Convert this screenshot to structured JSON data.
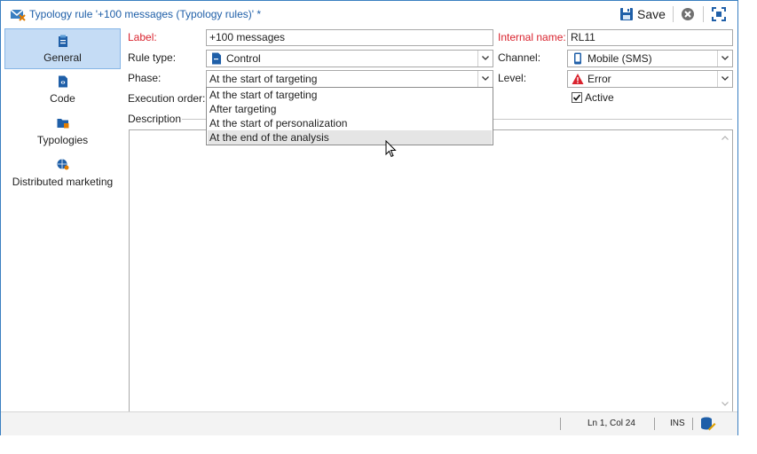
{
  "window": {
    "title": "Typology rule '+100 messages (Typology rules)' *"
  },
  "toolbar": {
    "save_label": "Save"
  },
  "sidebar": {
    "items": [
      {
        "label": "General",
        "icon": "clipboard-icon",
        "active": true
      },
      {
        "label": "Code",
        "icon": "code-document-icon",
        "active": false
      },
      {
        "label": "Typologies",
        "icon": "folder-icon",
        "active": false
      },
      {
        "label": "Distributed marketing",
        "icon": "globe-user-icon",
        "active": false
      }
    ]
  },
  "form": {
    "label_caption": "Label:",
    "label_value": "+100 messages",
    "internal_name_caption": "Internal name:",
    "internal_name_value": "RL11",
    "rule_type_caption": "Rule type:",
    "rule_type_value": "Control",
    "channel_caption": "Channel:",
    "channel_value": "Mobile (SMS)",
    "phase_caption": "Phase:",
    "phase_value": "At the start of targeting",
    "level_caption": "Level:",
    "level_value": "Error",
    "execution_order_caption": "Execution order:",
    "active_label": "Active",
    "active_checked": true,
    "description_caption": "Description"
  },
  "phase_dropdown": {
    "options": [
      "At the start of targeting",
      "After targeting",
      "At the start of personalization",
      "At the end of the analysis"
    ],
    "hovered_index": 3
  },
  "statusbar": {
    "position": "Ln 1, Col 24",
    "mode": "INS"
  },
  "colors": {
    "accent": "#1f5fa8",
    "required": "#d9232e",
    "active_nav_bg": "#c5dcf5",
    "error": "#d9232e"
  }
}
